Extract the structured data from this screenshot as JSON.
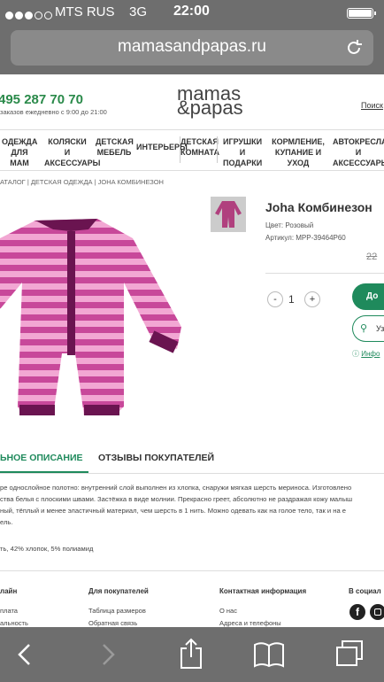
{
  "status": {
    "carrier": "MTS RUS",
    "network": "3G",
    "time": "22:00"
  },
  "browser": {
    "url": "mamasandpapas.ru"
  },
  "header": {
    "phone": "495 287 70 70",
    "hours": "заказов ежедневно с 9:00 до 21:00",
    "logo_top": "mamas",
    "logo_bottom": "&papas",
    "search": "Поиск"
  },
  "nav": [
    {
      "label": "ОДЕЖДА ДЛЯ МАМ"
    },
    {
      "label": "КОЛЯСКИ И АКСЕССУАРЫ"
    },
    {
      "label": "ДЕТСКАЯ МЕБЕЛЬ"
    },
    {
      "label": "ИНТЕРЬЕРЫ"
    },
    {
      "label": "ДЕТСКАЯ КОМНАТА"
    },
    {
      "label": "ИГРУШКИ И ПОДАРКИ"
    },
    {
      "label": "КОРМЛЕНИЕ, КУПАНИЕ И УХОД"
    },
    {
      "label": "АВТОКРЕСЛА И АКСЕССУАРЫ"
    }
  ],
  "breadcrumb": "АТАЛОГ | ДЕТСКАЯ ОДЕЖДА | JOHA КОМБИНЕЗОН",
  "product": {
    "title": "Joha Комбинезон",
    "color": "Цвет: Розовый",
    "article": "Артикул: MPP-39464P60",
    "price": "22",
    "qty": "1",
    "minus": "-",
    "plus": "+",
    "add_to_cart": "До",
    "pickup": "Уз",
    "info": "Инфо"
  },
  "tabs": {
    "description": "ЬНОЕ ОПИСАНИЕ",
    "reviews": "ОТЗЫВЫ ПОКУПАТЕЛЕЙ"
  },
  "description": {
    "line1": "ре однослойное полотно: внутренний слой выполнен из хлопка, снаружи мягкая шерсть мериноса. Изготовлено",
    "line2": "ства белья с плоскими швами. Застёжка в виде молнии. Прекрасно греет, абсолютно не раздражая кожу малыш",
    "line3": "ный, тёплый и менее эластичный материал, чем шерсть в 1 нить. Можно одевать как на голое тело, так и на е",
    "line4": "ель.",
    "composition": "ть, 42% хлопок, 5% полиамид"
  },
  "footer": {
    "col1_title": "лайн",
    "col1_item1": "плата",
    "col1_item2": "альность",
    "col2_title": "Для покупателей",
    "col2_item1": "Таблица размеров",
    "col2_item2": "Обратная связь",
    "col3_title": "Контактная информация",
    "col3_item1": "О нас",
    "col3_item2": "Адреса и телефоны",
    "col4_title": "В социал"
  },
  "colors": {
    "green": "#1f8a5c",
    "accent": "#a0287a",
    "chrome": "#6e6e6e"
  }
}
